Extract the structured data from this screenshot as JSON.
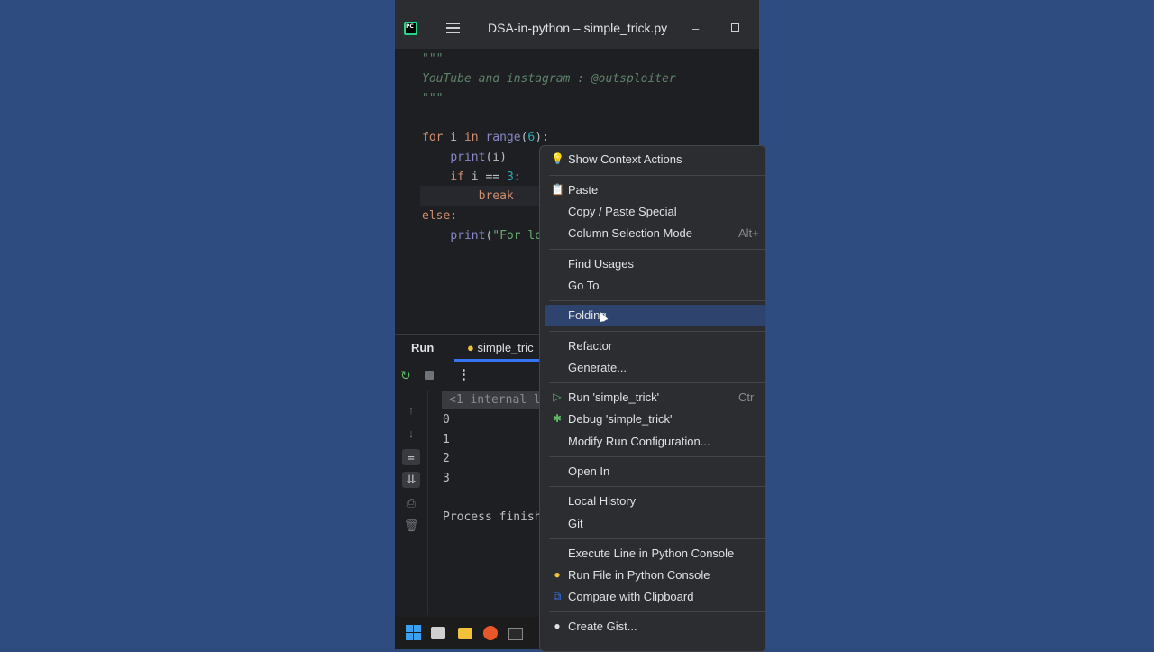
{
  "window": {
    "title": "DSA-in-python – simple_trick.py",
    "minimize": "–"
  },
  "editor": {
    "lines": [
      "\"\"\"",
      "YouTube and instagram : @outsploiter",
      "\"\"\"",
      "",
      "for i in range(6):",
      "    print(i)",
      "    if i == 3:",
      "        break",
      "else:",
      "    print(\"For lo"
    ]
  },
  "run_panel": {
    "title": "Run",
    "tab": "simple_tric",
    "hint": "<1 internal l",
    "output": [
      "0",
      "1",
      "2",
      "3",
      "",
      "Process finish"
    ]
  },
  "context_menu": {
    "items": [
      {
        "label": "Show Context Actions",
        "icon": "lightbulb-icon",
        "shortcut": ""
      },
      {
        "label": "Paste",
        "icon": "clipboard-icon",
        "shortcut": ""
      },
      {
        "label": "Copy / Paste Special",
        "icon": "",
        "shortcut": ""
      },
      {
        "label": "Column Selection Mode",
        "icon": "",
        "shortcut": "Alt+"
      },
      {
        "label": "Find Usages",
        "icon": "",
        "shortcut": ""
      },
      {
        "label": "Go To",
        "icon": "",
        "shortcut": ""
      },
      {
        "label": "Folding",
        "icon": "",
        "shortcut": "",
        "selected": true
      },
      {
        "label": "Refactor",
        "icon": "",
        "shortcut": ""
      },
      {
        "label": "Generate...",
        "icon": "",
        "shortcut": ""
      },
      {
        "label": "Run 'simple_trick'",
        "icon": "run-icon",
        "shortcut": "Ctr"
      },
      {
        "label": "Debug 'simple_trick'",
        "icon": "debug-icon",
        "shortcut": ""
      },
      {
        "label": "Modify Run Configuration...",
        "icon": "",
        "shortcut": ""
      },
      {
        "label": "Open In",
        "icon": "",
        "shortcut": ""
      },
      {
        "label": "Local History",
        "icon": "",
        "shortcut": ""
      },
      {
        "label": "Git",
        "icon": "",
        "shortcut": ""
      },
      {
        "label": "Execute Line in Python Console",
        "icon": "",
        "shortcut": ""
      },
      {
        "label": "Run File in Python Console",
        "icon": "python-icon",
        "shortcut": ""
      },
      {
        "label": "Compare with Clipboard",
        "icon": "compare-icon",
        "shortcut": ""
      },
      {
        "label": "Create Gist...",
        "icon": "github-icon",
        "shortcut": ""
      }
    ]
  },
  "colors": {
    "accent": "#3574f0",
    "selection": "#2e436e",
    "menu_bg": "#2b2d30"
  }
}
